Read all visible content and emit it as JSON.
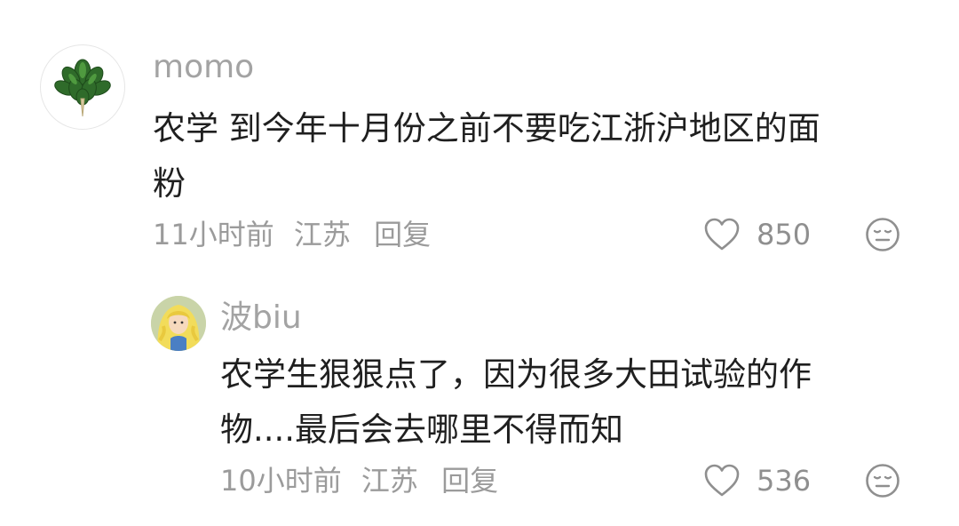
{
  "comments": [
    {
      "username": "momo",
      "text_line1": "农学 到今年十月份之前不要吃江浙沪地区的面",
      "text_line2": "粉",
      "time": "11小时前",
      "location": "江苏",
      "reply_label": "回复",
      "likes": "850"
    },
    {
      "username": "波biu",
      "text_line1": "农学生狠狠点了，因为很多大田试验的作",
      "text_line2": "物....最后会去哪里不得而知",
      "time": "10小时前",
      "location": "江苏",
      "reply_label": "回复",
      "likes": "536"
    }
  ],
  "icons": {
    "like": "heart-outline-icon",
    "reaction": "neutral-face-icon",
    "avatar_main": "green-leaves-avatar",
    "avatar_reply": "cartoon-girl-avatar"
  },
  "colors": {
    "username": "#a3a3a3",
    "text": "#1f1f1f",
    "meta": "#9b9b9b",
    "icon": "#8f8f8f"
  }
}
